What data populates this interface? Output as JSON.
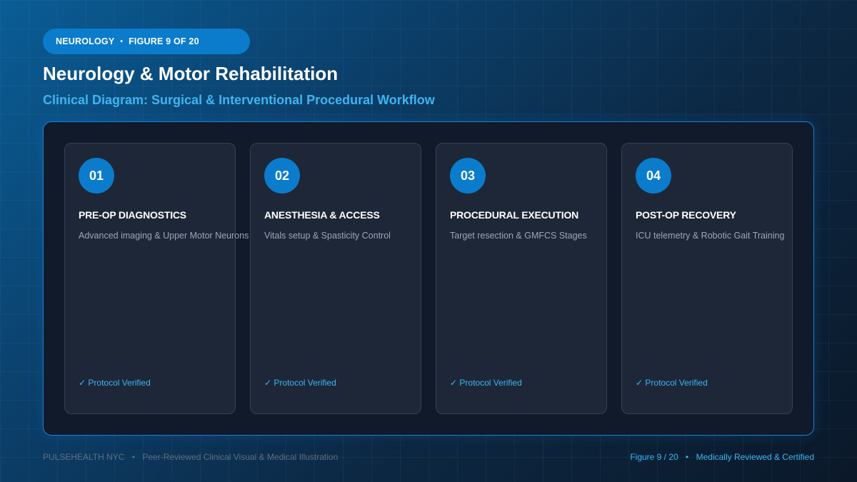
{
  "badge": {
    "category": "NEUROLOGY",
    "separator": "•",
    "figure": "FIGURE 9 OF 20"
  },
  "header": {
    "title": "Neurology & Motor Rehabilitation",
    "subtitle": "Clinical Diagram: Surgical & Interventional Procedural Workflow"
  },
  "steps": [
    {
      "number": "01",
      "title": "PRE-OP DIAGNOSTICS",
      "description": "Advanced imaging & Upper Motor Neurons",
      "status": "✓ Protocol Verified"
    },
    {
      "number": "02",
      "title": "ANESTHESIA & ACCESS",
      "description": "Vitals setup & Spasticity Control",
      "status": "✓ Protocol Verified"
    },
    {
      "number": "03",
      "title": "PROCEDURAL EXECUTION",
      "description": "Target resection & GMFCS Stages",
      "status": "✓ Protocol Verified"
    },
    {
      "number": "04",
      "title": "POST-OP RECOVERY",
      "description": "ICU telemetry & Robotic Gait Training",
      "status": "✓ Protocol Verified"
    }
  ],
  "footer": {
    "brand": "PULSEHEALTH NYC",
    "tagline": "Peer-Reviewed Clinical Visual & Medical Illustration",
    "figure": "Figure 9 / 20",
    "certification": "Medically Reviewed & Certified",
    "separator": "•"
  },
  "colors": {
    "accent": "#0b7ccc",
    "accent_text": "#3eb5f1",
    "panel_border": "#1b7fcf",
    "card_bg": "#1d2738",
    "panel_bg": "#101a2b"
  }
}
